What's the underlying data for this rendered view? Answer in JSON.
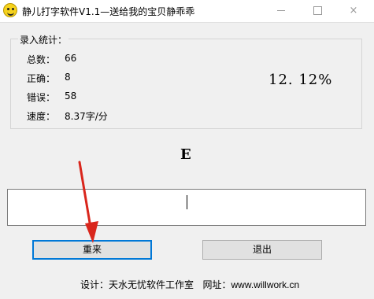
{
  "window": {
    "title": "静儿打字软件V1.1—送给我的宝贝静乖乖",
    "icon": "smiley-icon",
    "controls": {
      "minimize": "minimize-icon",
      "maximize": "maximize-icon",
      "close": "×"
    }
  },
  "stats": {
    "legend": "录入统计：",
    "total_label": "总数：",
    "total_value": "66",
    "correct_label": "正确：",
    "correct_value": "8",
    "wrong_label": "错误：",
    "wrong_value": "58",
    "speed_label": "速度：",
    "speed_value": "8.37字/分",
    "accuracy": "12. 12%"
  },
  "target_char": "E",
  "input": {
    "value": ""
  },
  "buttons": {
    "reset": "重来",
    "quit": "退出"
  },
  "footer": {
    "design_label": "设计：",
    "studio": "天水无忧软件工作室",
    "site_label": "网址：",
    "site": "www.willwork.cn"
  },
  "annotation": {
    "arrow_color": "#d9261c"
  }
}
